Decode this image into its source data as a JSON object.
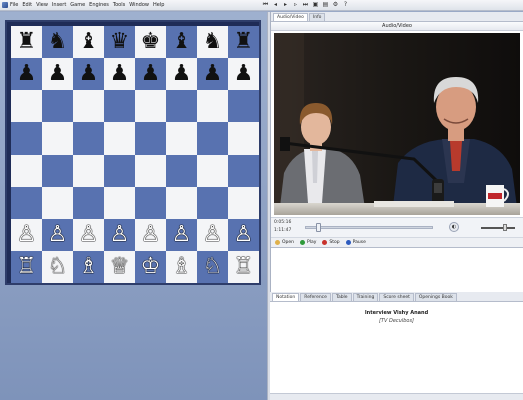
{
  "menu": [
    "File",
    "Edit",
    "View",
    "Insert",
    "Game",
    "Engines",
    "Tools",
    "Window",
    "Help"
  ],
  "toolbar_icons": [
    "skip-back-icon",
    "step-back-icon",
    "play-icon",
    "step-forward-icon",
    "skip-forward-icon",
    "save-icon",
    "print-icon",
    "settings-icon",
    "help-icon"
  ],
  "board": {
    "rows": [
      [
        "♜",
        "♞",
        "♝",
        "♛",
        "♚",
        "♝",
        "♞",
        "♜"
      ],
      [
        "♟",
        "♟",
        "♟",
        "♟",
        "♟",
        "♟",
        "♟",
        "♟"
      ],
      [
        "",
        "",
        "",
        "",
        "",
        "",
        "",
        ""
      ],
      [
        "",
        "",
        "",
        "",
        "",
        "",
        "",
        ""
      ],
      [
        "",
        "",
        "",
        "",
        "",
        "",
        "",
        ""
      ],
      [
        "",
        "",
        "",
        "",
        "",
        "",
        "",
        ""
      ],
      [
        "♙",
        "♙",
        "♙",
        "♙",
        "♙",
        "♙",
        "♙",
        "♙"
      ],
      [
        "♖",
        "♘",
        "♗",
        "♕",
        "♔",
        "♗",
        "♘",
        "♖"
      ]
    ],
    "light_color": "#f4f5f7",
    "dark_color": "#5872b0"
  },
  "video_panel": {
    "tabs": [
      "Audio/Video",
      "Info"
    ],
    "title": "Audio/Video",
    "time_current": "0:05:16",
    "time_total": "1:11:47",
    "progress": 0.1
  },
  "playbar": {
    "open": "Open",
    "play": "Play",
    "stop": "Stop",
    "pause": "Pause"
  },
  "notation_panel": {
    "tabs": [
      "Notation",
      "Reference",
      "Table",
      "Training",
      "Score sheet",
      "Openings Book"
    ],
    "title": "Interview Vishy Anand",
    "subtitle": "[TV Deculbos]"
  }
}
